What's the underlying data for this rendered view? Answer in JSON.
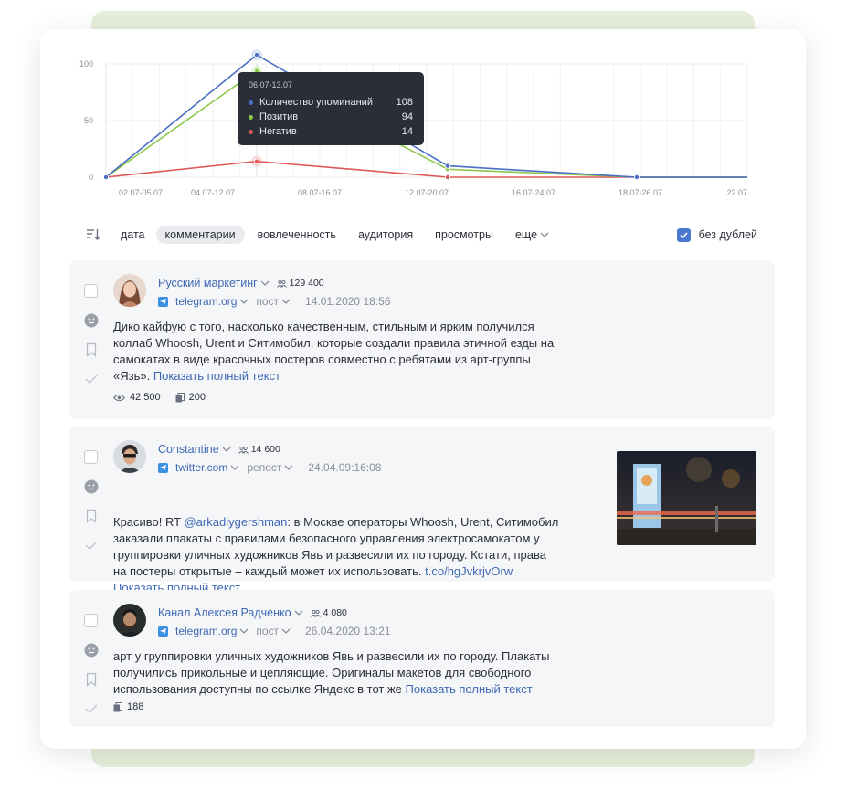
{
  "chart_data": {
    "type": "line",
    "x": [
      "02.07-05.07",
      "04.07-12.07",
      "08.07-16.07",
      "12.07-20.07",
      "16.07-24.07",
      "18.07-26.07",
      "22.07"
    ],
    "y_ticks": [
      "100",
      "50",
      "0"
    ],
    "ylim": [
      0,
      100
    ],
    "series": [
      {
        "name": "Количество упоминаний",
        "color": "#4a6fc4",
        "points": [
          [
            0,
            0
          ],
          [
            1,
            108
          ],
          [
            3,
            10
          ],
          [
            5,
            0
          ],
          [
            6,
            0
          ]
        ]
      },
      {
        "name": "Позитив",
        "color": "#8cc84b",
        "points": [
          [
            0,
            0
          ],
          [
            1,
            94
          ],
          [
            3,
            7
          ],
          [
            5,
            0
          ],
          [
            6,
            0
          ]
        ]
      },
      {
        "name": "Негатив",
        "color": "#e05757",
        "points": [
          [
            0,
            0
          ],
          [
            1,
            14
          ],
          [
            3,
            0
          ],
          [
            5,
            0
          ],
          [
            6,
            0
          ]
        ]
      }
    ],
    "grid": true,
    "tooltip": {
      "title": "06.07-13.07",
      "rows": [
        {
          "label": "Количество упоминаний",
          "value": "108",
          "color": "#4a6fc4"
        },
        {
          "label": "Позитив",
          "value": "94",
          "color": "#8cc84b"
        },
        {
          "label": "Негатив",
          "value": "14",
          "color": "#e05757"
        }
      ]
    }
  },
  "toolbar": {
    "tabs": [
      "дата",
      "комментарии",
      "вовлеченность",
      "аудитория",
      "просмотры"
    ],
    "active_tab": "комментарии",
    "more_label": "еще",
    "no_duplicates_label": "без дублей",
    "no_duplicates_checked": true
  },
  "posts": [
    {
      "author": "Русский маркетинг",
      "subscribers": "129 400",
      "source": "telegram.org",
      "type": "пост",
      "date": "14.01.2020 18:56",
      "text_lines": [
        "Дико кайфую с того, насколько качественным, стильным и ярким получился",
        "коллаб Whoosh, Urent и Ситимобил, которые создали правила этичной езды на",
        "самокатах в виде красочных постеров совместно с ребятами из арт-группы"
      ],
      "text_last": "«Язь». ",
      "show_more": "Показать полный текст",
      "views": "42 500",
      "copies": "200"
    },
    {
      "author": "Constantine",
      "subscribers": "14 600",
      "source": "twitter.com",
      "type": "репост",
      "date": "24.04.09:16:08",
      "text_first_prefix": "Красиво! RT ",
      "mention": "@arkadiygershman",
      "text_first_suffix": ": в Москве операторы Whoosh, Urent, Ситимобил",
      "text_lines": [
        "заказали плакаты с правилами безопасного управления электросамокатом у",
        "группировки уличных художников Явь и развесили их по городу. Кстати, права"
      ],
      "text_last": "на постеры открытые – каждый может их использовать. ",
      "link": "t.co/hgJvkrjvOrw",
      "show_more": "Показать полный текст"
    },
    {
      "author": "Канал Алексея Радченко",
      "subscribers": "4 080",
      "source": "telegram.org",
      "type": "пост",
      "date": "26.04.2020 13:21",
      "text_lines": [
        "арт у группировки уличных художников Явь и развесили их по городу. Плакаты",
        "получились прикольные и цепляющие. Оригиналы макетов для свободного"
      ],
      "text_last": "использования доступны по ссылке Яндекс в тот же ",
      "show_more": "Показать полный текст",
      "copies": "188"
    }
  ]
}
